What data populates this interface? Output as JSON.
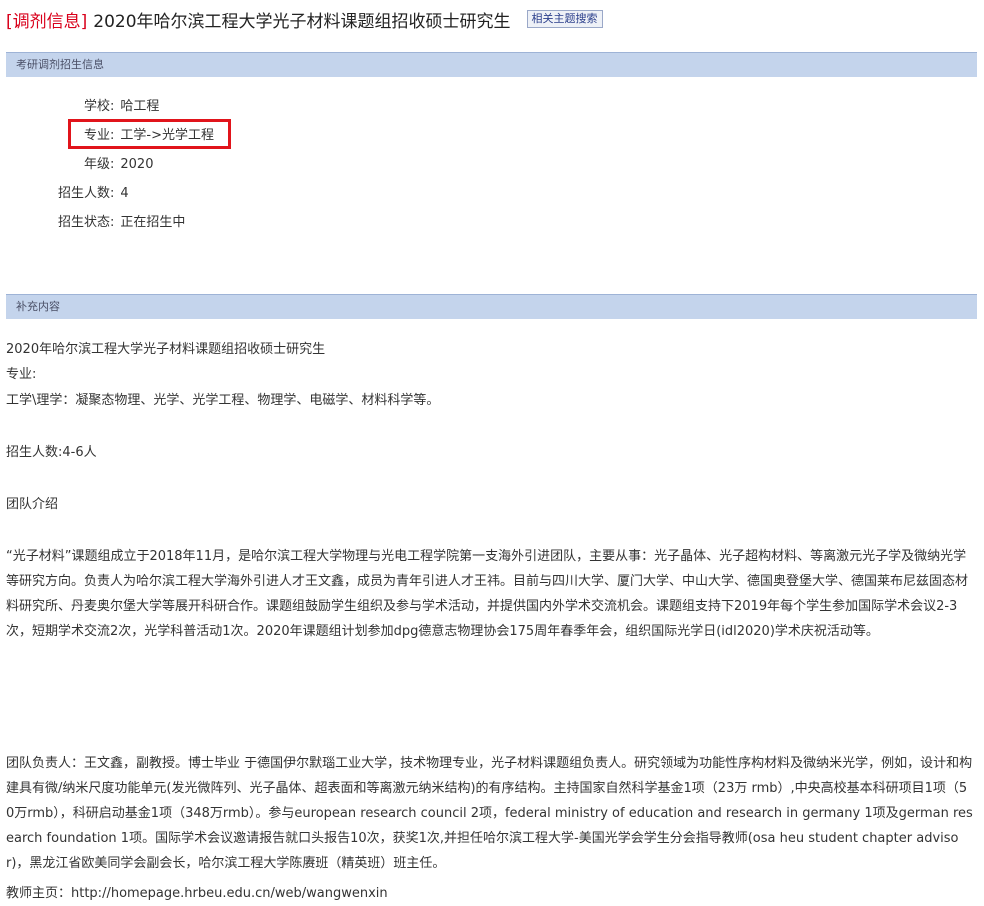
{
  "header": {
    "tag": "[调剂信息]",
    "title": "2020年哈尔滨工程大学光子材料课题组招收硕士研究生",
    "search_button": "相关主题搜索"
  },
  "section1": {
    "title": "考研调剂招生信息",
    "rows": [
      {
        "label": "学校",
        "value": "哈工程"
      },
      {
        "label": "专业",
        "value": "工学->光学工程"
      },
      {
        "label": "年级",
        "value": "2020"
      },
      {
        "label": "招生人数",
        "value": "4"
      },
      {
        "label": "招生状态",
        "value": "正在招生中"
      }
    ],
    "separator": ":"
  },
  "section2": {
    "title": "补充内容",
    "lines": [
      "2020年哈尔滨工程大学光子材料课题组招收硕士研究生",
      "专业:",
      "工学\\理学：凝聚态物理、光学、光学工程、物理学、电磁学、材料科学等。",
      "招生人数:4-6人",
      "团队介绍",
      "“光子材料”课题组成立于2018年11月，是哈尔滨工程大学物理与光电工程学院第一支海外引进团队，主要从事：光子晶体、光子超构材料、等离激元光子学及微纳光学等研究方向。负责人为哈尔滨工程大学海外引进人才王文鑫，成员为青年引进人才王祎。目前与四川大学、厦门大学、中山大学、德国奥登堡大学、德国莱布尼兹固态材料研究所、丹麦奥尔堡大学等展开科研合作。课题组鼓励学生组织及参与学术活动，并提供国内外学术交流机会。课题组支持下2019年每个学生参加国际学术会议2-3次，短期学术交流2次，光学科普活动1次。2020年课题组计划参加dpg德意志物理协会175周年春季年会，组织国际光学日(idl2020)学术庆祝活动等。",
      "团队负责人：王文鑫，副教授。博士毕业 于德国伊尔默瑙工业大学，技术物理专业，光子材料课题组负责人。研究领域为功能性序构材料及微纳米光学，例如，设计和构建具有微/纳米尺度功能单元(发光微阵列、光子晶体、超表面和等离激元纳米结构)的有序结构。主持国家自然科学基金1项（23万 rmb）,中央高校基本科研项目1项（50万rmb），科研启动基金1项（348万rmb）。参与european research council 2项，federal ministry of education and research in germany 1项及german research foundation 1项。国际学术会议邀请报告就口头报告10次，获奖1次,并担任哈尔滨工程大学-美国光学会学生分会指导教师(osa heu student chapter advisor)，黑龙江省欧美同学会副会长，哈尔滨工程大学陈赓班（精英班）班主任。",
      "教师主页：http://homepage.hrbeu.edu.cn/web/wangwenxin"
    ]
  },
  "colors": {
    "tag": "#d9001b",
    "section_bar": "#c4d4ec",
    "highlight": "#e1141b"
  }
}
